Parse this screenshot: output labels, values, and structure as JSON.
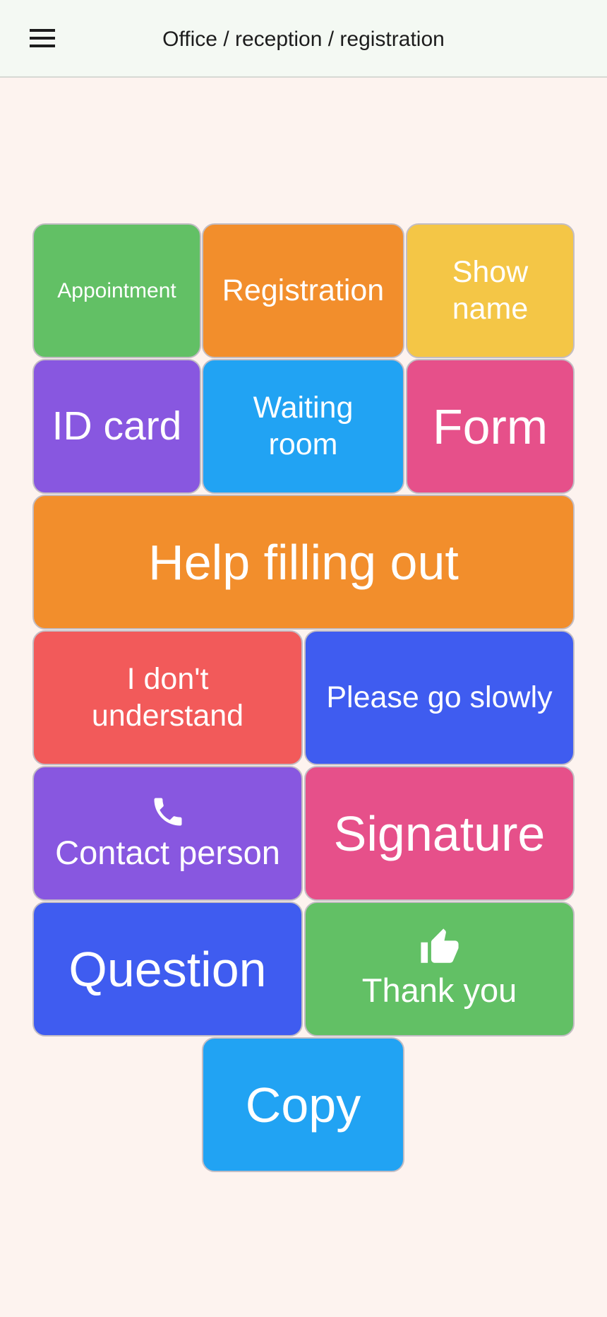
{
  "header": {
    "title": "Office / reception / registration",
    "menu_icon": "menu-icon"
  },
  "colors": {
    "background": "#fdf3ef",
    "appbar": "#f4f9f3",
    "green": "#62c065",
    "orange": "#f28e2c",
    "yellow": "#f4c646",
    "purple": "#8857e0",
    "sky": "#21a3f3",
    "pink": "#e6508a",
    "red": "#f25a5a",
    "indigo": "#3f5cf0"
  },
  "tiles": [
    {
      "label": "Appointment",
      "color": "green"
    },
    {
      "label": "Registration",
      "color": "orange"
    },
    {
      "label": "Show name",
      "color": "yellow"
    },
    {
      "label": "ID card",
      "color": "purple"
    },
    {
      "label": "Waiting room",
      "color": "sky"
    },
    {
      "label": "Form",
      "color": "pink"
    },
    {
      "label": "Help filling out",
      "color": "orange"
    },
    {
      "label": "I don't understand",
      "color": "red"
    },
    {
      "label": "Please go slowly",
      "color": "indigo"
    },
    {
      "label": "Contact person",
      "color": "purple",
      "icon": "phone-icon"
    },
    {
      "label": "Signature",
      "color": "pink"
    },
    {
      "label": "Question",
      "color": "indigo"
    },
    {
      "label": "Thank you",
      "color": "green",
      "icon": "thumbs-up-icon"
    },
    {
      "label": "Copy",
      "color": "sky"
    }
  ]
}
